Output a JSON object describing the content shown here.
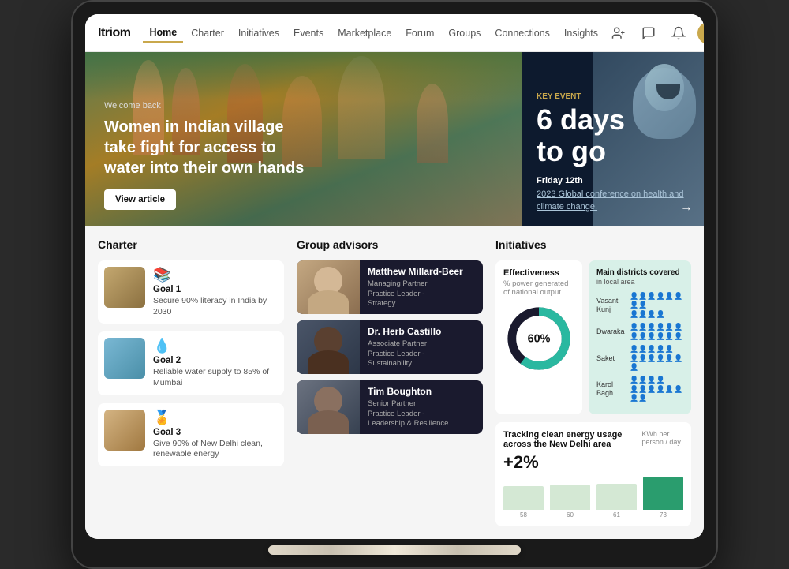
{
  "brand": "Itriom",
  "nav": {
    "items": [
      {
        "label": "Home",
        "active": true
      },
      {
        "label": "Charter",
        "active": false
      },
      {
        "label": "Initiatives",
        "active": false
      },
      {
        "label": "Events",
        "active": false
      },
      {
        "label": "Marketplace",
        "active": false
      },
      {
        "label": "Forum",
        "active": false
      },
      {
        "label": "Groups",
        "active": false
      },
      {
        "label": "Connections",
        "active": false
      },
      {
        "label": "Insights",
        "active": false
      }
    ]
  },
  "hero": {
    "welcome": "Welcome back",
    "title": "Women in Indian village take fight for access to water into their own hands",
    "cta": "View article",
    "key_event_label": "Key event",
    "days_text": "6 days\nto go",
    "event_date": "Friday 12th",
    "event_name": "2023 Global conference on health and climate change."
  },
  "charter": {
    "section_title": "Charter",
    "goals": [
      {
        "name": "Goal 1",
        "icon": "📖",
        "desc": "Secure 90% literacy in India by 2030"
      },
      {
        "name": "Goal 2",
        "icon": "💧",
        "desc": "Reliable water supply to 85% of Mumbai"
      },
      {
        "name": "Goal 3",
        "icon": "🏅",
        "desc": "Give 90% of New Delhi clean, renewable energy"
      }
    ]
  },
  "advisors": {
    "section_title": "Group advisors",
    "people": [
      {
        "name": "Matthew Millard-Beer",
        "role": "Managing Partner\nPractice Leader - Strategy"
      },
      {
        "name": "Dr. Herb Castillo",
        "role": "Associate Partner\nPractice Leader - Sustainability"
      },
      {
        "name": "Tim Boughton",
        "role": "Senior Partner\nPractice Leader - Leadership & Resilience"
      }
    ]
  },
  "initiatives": {
    "section_title": "Initiatives",
    "effectiveness": {
      "title": "Effectiveness",
      "subtitle": "% power generated of national output",
      "value": "60%",
      "pct": 60
    },
    "districts": {
      "title": "Main districts covered",
      "subtitle": "in local area",
      "rows": [
        {
          "name": "Vasant Kunj",
          "filled": 8,
          "total": 12
        },
        {
          "name": "Dwaraka",
          "filled": 6,
          "total": 12
        },
        {
          "name": "Saket",
          "filled": 5,
          "total": 12
        },
        {
          "name": "Karol Bagh",
          "filled": 4,
          "total": 12
        }
      ]
    },
    "tracking": {
      "title": "Tracking clean energy usage across the New Delhi area",
      "unit": "KWh per person / day",
      "pct": "+2%",
      "bars": [
        {
          "label": "58",
          "value": 58,
          "color": "#d4e8d4"
        },
        {
          "label": "60",
          "value": 60,
          "color": "#d4e8d4"
        },
        {
          "label": "61",
          "value": 61,
          "color": "#d4e8d4"
        },
        {
          "label": "73",
          "value": 73,
          "color": "#2a9d6e"
        }
      ]
    }
  }
}
